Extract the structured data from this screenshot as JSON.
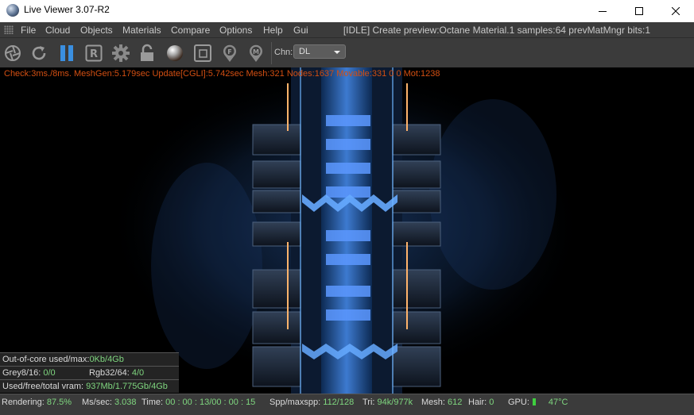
{
  "window": {
    "title": "Live Viewer 3.07-R2"
  },
  "menu": {
    "items": [
      "File",
      "Cloud",
      "Objects",
      "Materials",
      "Compare",
      "Options",
      "Help",
      "Gui"
    ],
    "status": "[IDLE] Create preview:Octane Material.1 samples:64   prevMatMngr bits:1"
  },
  "toolbar": {
    "icons": [
      "aperture-icon",
      "refresh-icon",
      "pause-icon",
      "r-icon",
      "gear-icon",
      "lock-icon",
      "material-sphere-icon",
      "region-icon",
      "f-pin-icon",
      "m-pin-icon"
    ],
    "channel_label": "Chn:",
    "channel_value": "DL"
  },
  "viewport": {
    "check_line": "Check:3ms./8ms. MeshGen:5.179sec Update[CGLI]:5.742sec Mesh:321 Nodes:1637 Movable:331  0 0 Mot:1238"
  },
  "info": {
    "out_of_core_label": "Out-of-core used/max:",
    "out_of_core_value": "0Kb/4Gb",
    "grey_label": "Grey8/16: ",
    "grey_value": "0/0",
    "rgb_label": "Rgb32/64: ",
    "rgb_value": "4/0",
    "vram_label": "Used/free/total vram: ",
    "vram_value": "937Mb/1.775Gb/4Gb"
  },
  "status": {
    "rendering_label": "Rendering: ",
    "rendering_value": "87.5%",
    "mssec_label": "Ms/sec: ",
    "mssec_value": "3.038",
    "time_label": "Time: ",
    "time_value": "00 : 00 : 13/00 : 00 : 15",
    "spp_label": "Spp/maxspp: ",
    "spp_value": "112/128",
    "tri_label": "Tri: ",
    "tri_value": "94k/977k",
    "mesh_label": "Mesh: ",
    "mesh_value": "612",
    "hair_label": "Hair: ",
    "hair_value": "0",
    "gpu_label": "GPU:",
    "gpu_temp": "47°C"
  },
  "colors": {
    "accent_green": "#7fd67f",
    "warning_orange": "#d34f12",
    "glow_blue": "#3f8cff"
  }
}
